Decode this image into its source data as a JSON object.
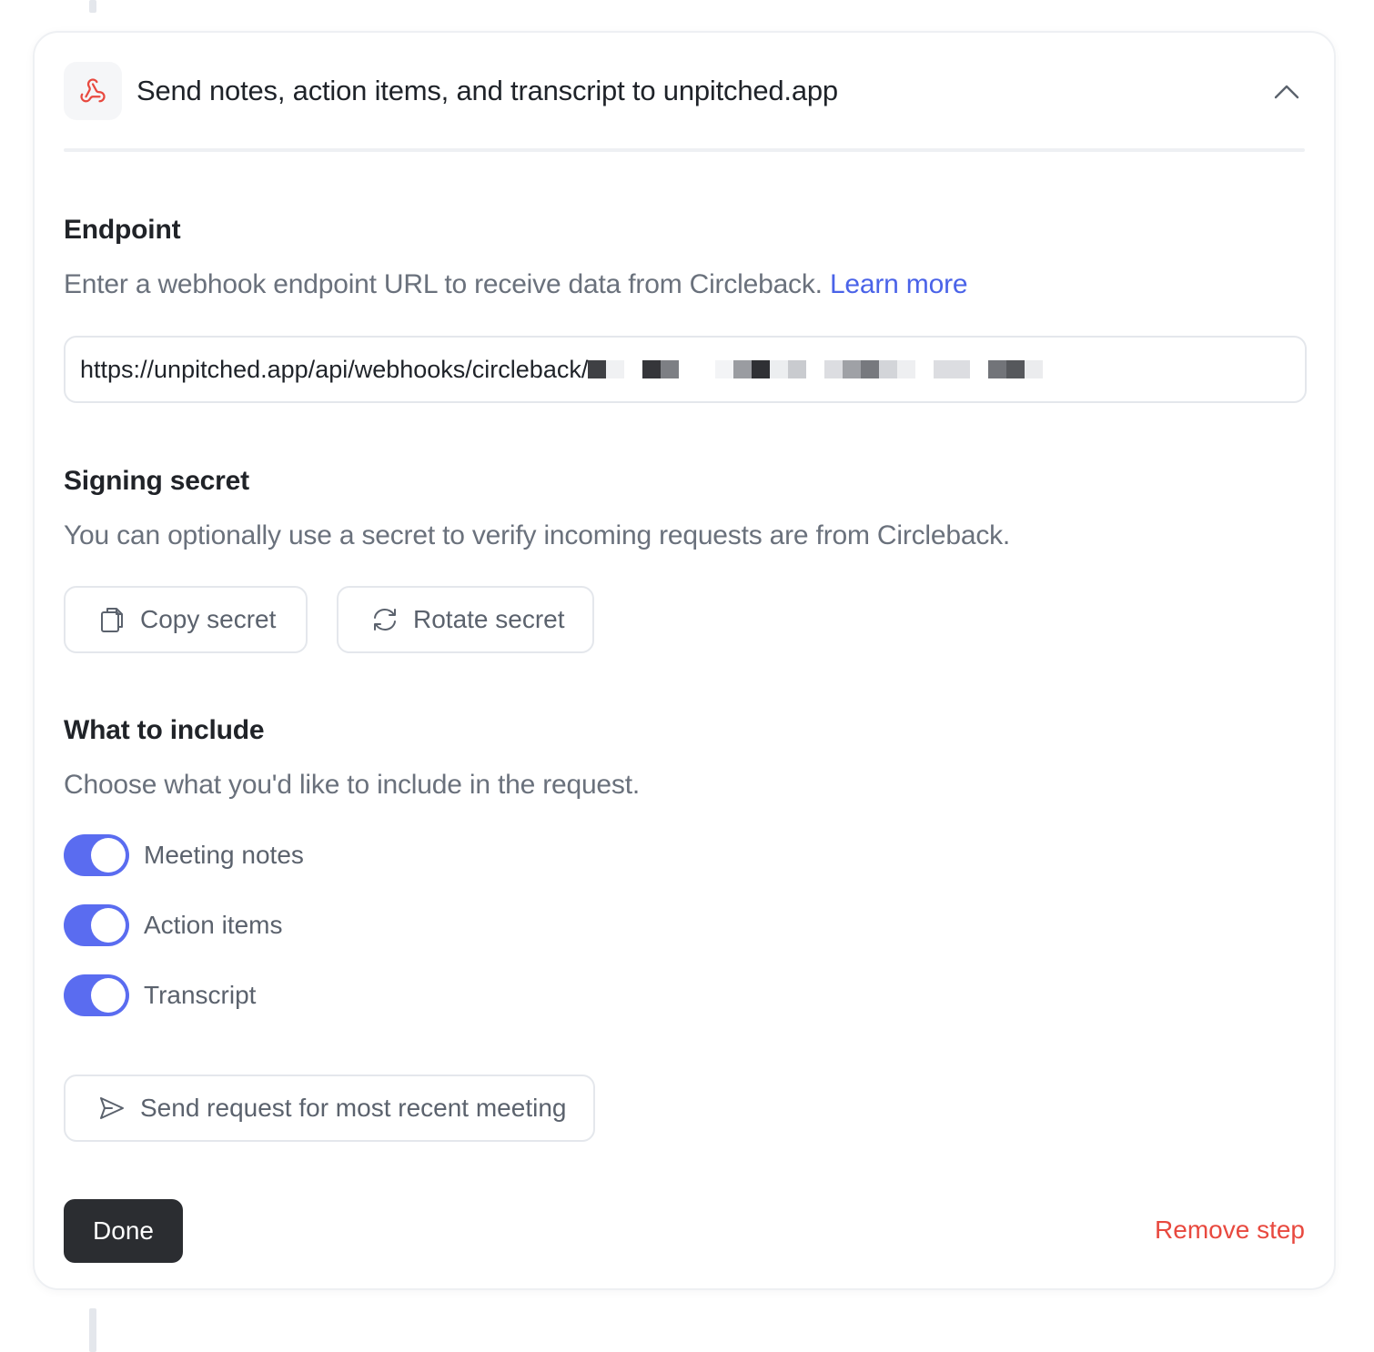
{
  "header": {
    "title": "Send notes, action items, and transcript to unpitched.app",
    "app_icon": "webhook-icon",
    "collapse_icon": "chevron-up-icon"
  },
  "endpoint": {
    "title": "Endpoint",
    "description": "Enter a webhook endpoint URL to receive data from Circleback.",
    "learn_more": "Learn more",
    "url_value": "https://unpitched.app/api/webhooks/circleback/"
  },
  "signing_secret": {
    "title": "Signing secret",
    "description": "You can optionally use a secret to verify incoming requests are from Circleback.",
    "copy_label": "Copy secret",
    "rotate_label": "Rotate secret"
  },
  "include": {
    "title": "What to include",
    "description": "Choose what you'd like to include in the request.",
    "options": [
      {
        "label": "Meeting notes",
        "enabled": true
      },
      {
        "label": "Action items",
        "enabled": true
      },
      {
        "label": "Transcript",
        "enabled": true
      }
    ]
  },
  "send_request_label": "Send request for most recent meeting",
  "footer": {
    "done_label": "Done",
    "remove_label": "Remove step"
  },
  "colors": {
    "accent": "#5a6cf0",
    "link": "#4a63e8",
    "danger": "#e8493f",
    "dark_button": "#2b2d31"
  }
}
